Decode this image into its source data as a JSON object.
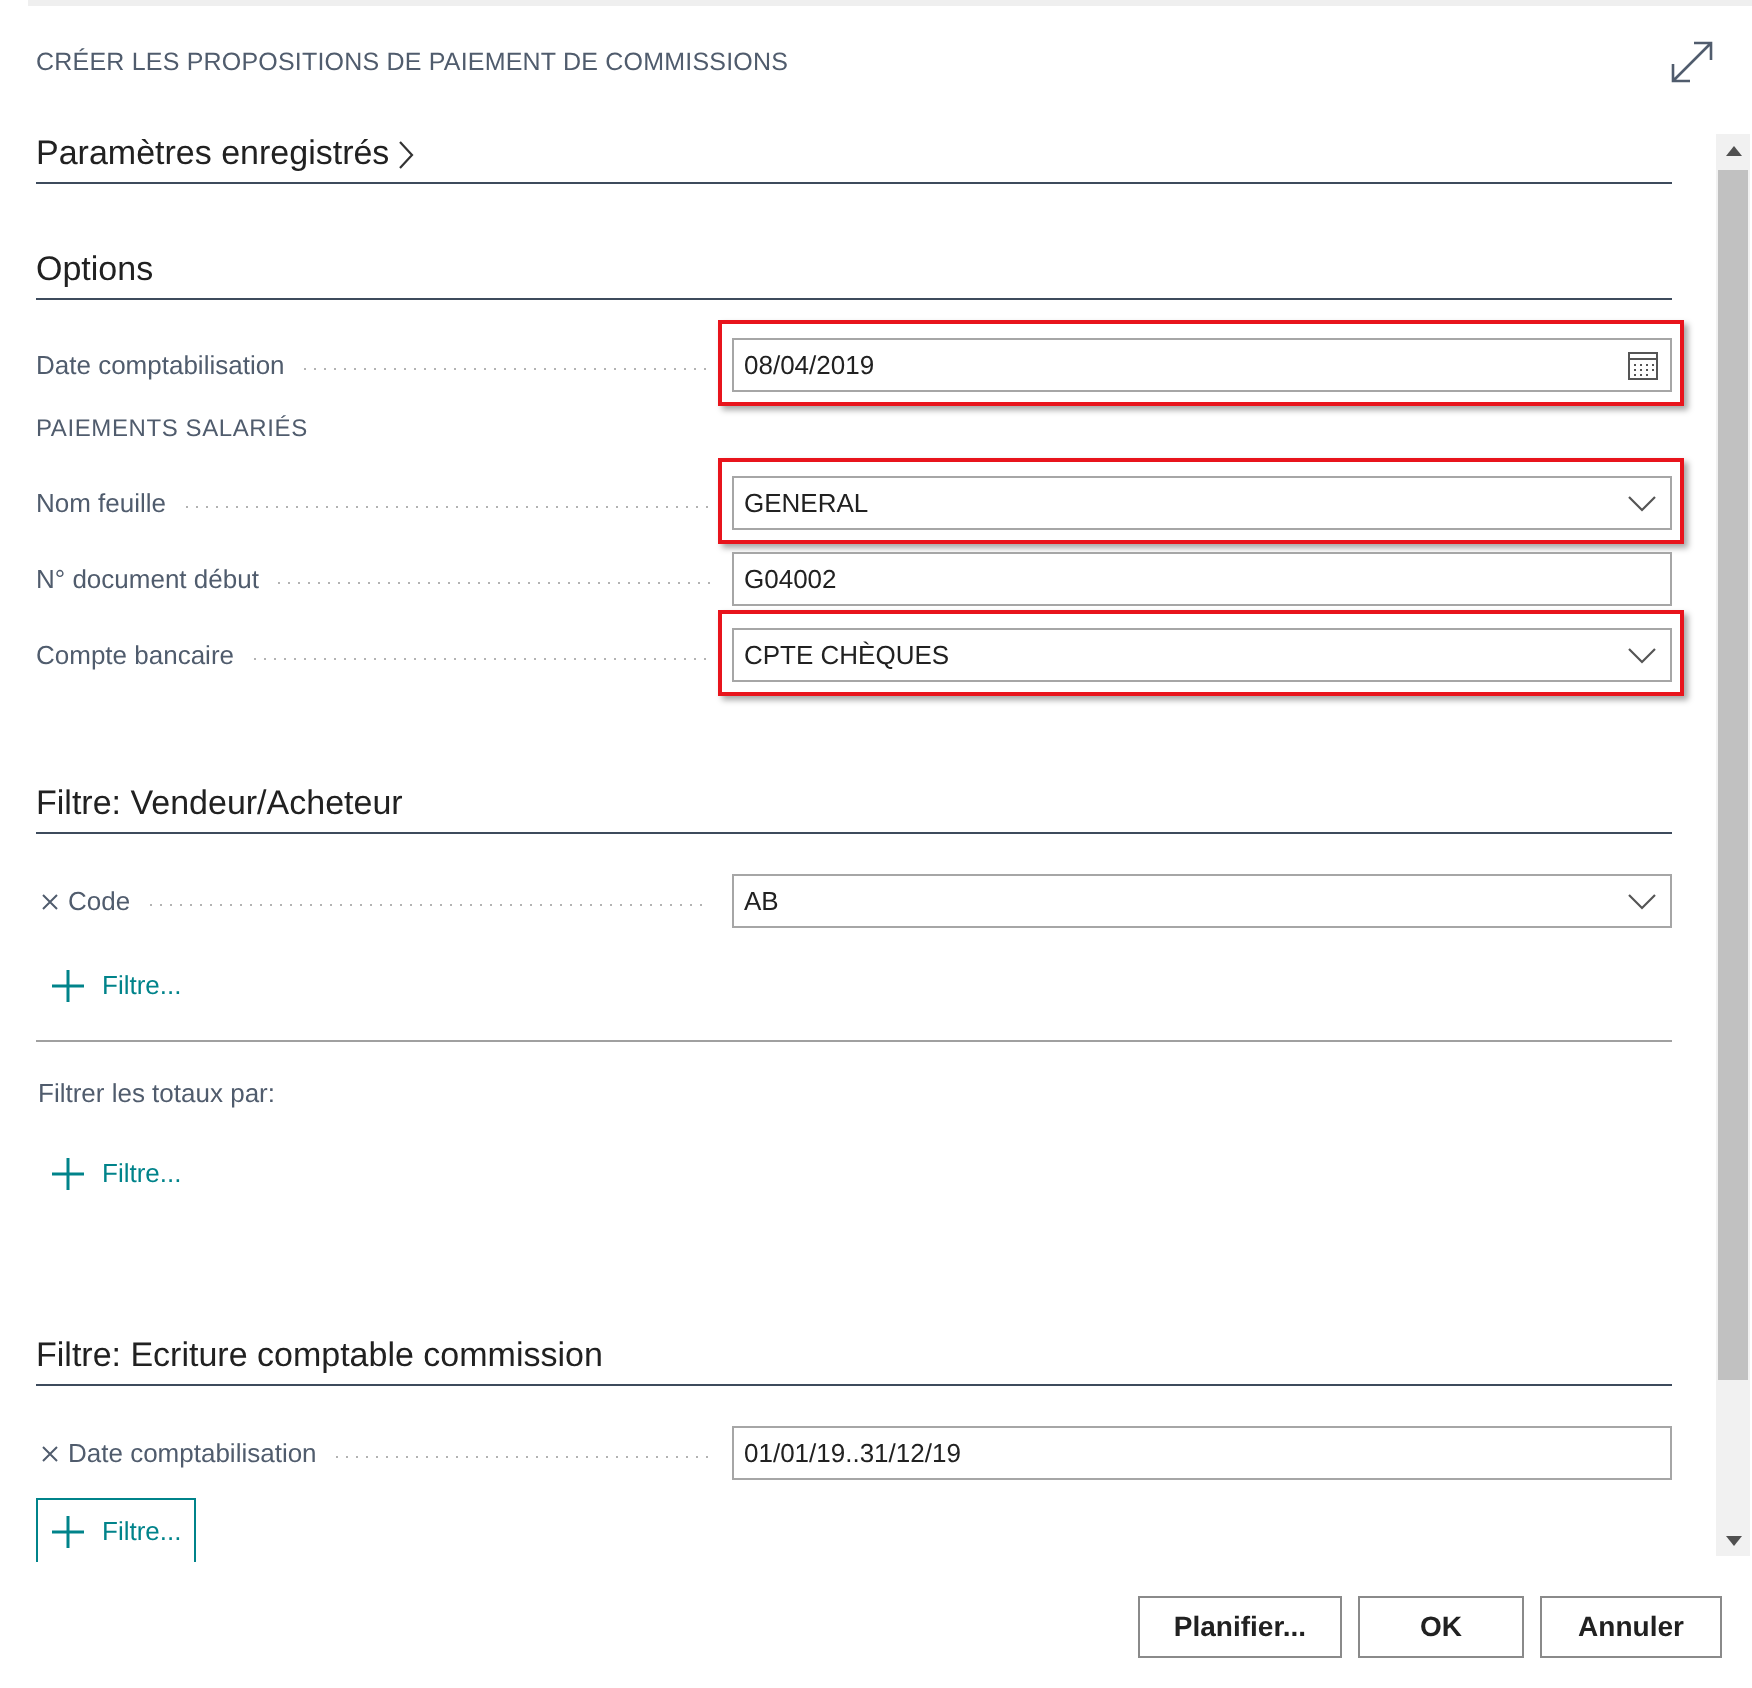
{
  "dialog": {
    "title": "CRÉER LES PROPOSITIONS DE PAIEMENT DE COMMISSIONS"
  },
  "saved_settings": {
    "heading": "Paramètres enregistrés"
  },
  "options": {
    "heading": "Options",
    "items": [
      {
        "kind": "date",
        "label": "Date comptabilisation",
        "value": "08/04/2019",
        "highlighted": true
      },
      {
        "kind": "subheading",
        "text": "PAIEMENTS SALARIÉS"
      },
      {
        "kind": "dropdown",
        "label": "Nom feuille",
        "value": "GENERAL",
        "highlighted": true
      },
      {
        "kind": "text",
        "label": "N° document début",
        "value": "G04002",
        "highlighted": false
      },
      {
        "kind": "dropdown",
        "label": "Compte bancaire",
        "value": "CPTE CHÈQUES",
        "highlighted": true
      }
    ]
  },
  "filter_salesperson": {
    "heading": "Filtre: Vendeur/Acheteur",
    "filters": [
      {
        "kind": "dropdown",
        "label": "Code",
        "value": "AB"
      }
    ],
    "add_filter": {
      "label": "Filtre...",
      "focused": false
    }
  },
  "totals_filter": {
    "label": "Filtrer les totaux par:",
    "add_filter": {
      "label": "Filtre...",
      "focused": false
    }
  },
  "filter_entries": {
    "heading": "Filtre: Ecriture comptable commission",
    "filters": [
      {
        "kind": "text",
        "label": "Date comptabilisation",
        "value": "01/01/19..31/12/19"
      }
    ],
    "add_filter": {
      "label": "Filtre...",
      "focused": true
    }
  },
  "buttons": [
    {
      "label": "Planifier..."
    },
    {
      "label": "OK"
    },
    {
      "label": "Annuler"
    }
  ]
}
